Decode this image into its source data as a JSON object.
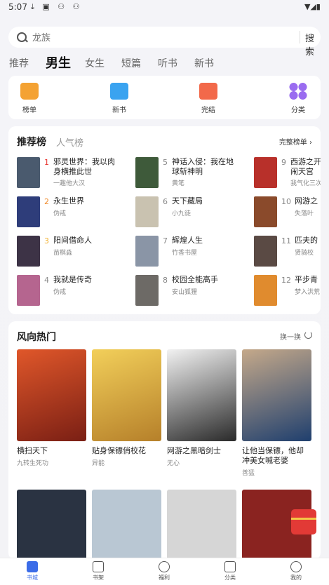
{
  "status_bar": {
    "time": "5:07",
    "notification_icons": "⤓ ▣ ⚇ ⚇"
  },
  "search": {
    "placeholder": "龙族",
    "button_label": "搜索"
  },
  "tabs": [
    {
      "label": "推荐"
    },
    {
      "label": "男生"
    },
    {
      "label": "女生"
    },
    {
      "label": "短篇"
    },
    {
      "label": "听书"
    },
    {
      "label": "新书"
    }
  ],
  "quick_links": [
    {
      "label": "榜单",
      "icon": "trophy-icon",
      "color": "#f4a233"
    },
    {
      "label": "新书",
      "icon": "new-book-icon",
      "color": "#3aa3f0"
    },
    {
      "label": "完结",
      "icon": "finished-icon",
      "color": "#f2694a"
    },
    {
      "label": "分类",
      "icon": "category-icon",
      "color": "#9a6cf0"
    }
  ],
  "rank_section": {
    "title": "推荐榜",
    "subtitle": "人气榜",
    "more_label": "完整榜单 ›",
    "items": [
      {
        "rank": "1",
        "title": "邪灵世界：我以肉\n身横推此世",
        "author": "一趣他大汉",
        "color": "#4a5a6e"
      },
      {
        "rank": "2",
        "title": "永生世界",
        "author": "伪戒",
        "color": "#2e3d7a"
      },
      {
        "rank": "3",
        "title": "阳间借命人",
        "author": "苗棋淼",
        "color": "#3d3346"
      },
      {
        "rank": "4",
        "title": "我就是传奇",
        "author": "伪戒",
        "color": "#b5658f"
      },
      {
        "rank": "5",
        "title": "神话入侵：我在地\n球斩神明",
        "author": "黄笔",
        "color": "#3e5a3a"
      },
      {
        "rank": "6",
        "title": "天下藏局",
        "author": "小九徒",
        "color": "#c9c2b0"
      },
      {
        "rank": "7",
        "title": "辉煌人生",
        "author": "竹香书屋",
        "color": "#8a95a6"
      },
      {
        "rank": "8",
        "title": "校园全能高手",
        "author": "安山狐狸",
        "color": "#6d6a66"
      },
      {
        "rank": "9",
        "title": "西游之开\n闹天宫",
        "author": "我气化三次",
        "color": "#b8302a"
      },
      {
        "rank": "10",
        "title": "网游之",
        "author": "失落叶",
        "color": "#8a4a2b"
      },
      {
        "rank": "11",
        "title": "匹夫的",
        "author": "贤骑校",
        "color": "#5a4a44"
      },
      {
        "rank": "12",
        "title": "平步青",
        "author": "梦入洪荒",
        "color": "#e08b2e"
      }
    ]
  },
  "hot_section": {
    "title": "风向热门",
    "refresh_label": "换一换",
    "books": [
      {
        "title": "横扫天下",
        "author": "九转生死功",
        "color": "#c0391f"
      },
      {
        "title": "贴身保镖俏校花",
        "author": "异能",
        "color": "#e3b23d"
      },
      {
        "title": "网游之黑暗剑士",
        "author": "无心",
        "color": "#3a3a3a"
      },
      {
        "title": "让他当保镖，他却\n冲美女喊老婆",
        "author": "善猛",
        "color": "#2f5a8a"
      }
    ],
    "more_covers": [
      {
        "color": "#2a3342"
      },
      {
        "color": "#b9c7d3"
      },
      {
        "color": "#d6d6d6"
      },
      {
        "color": "#8a2320"
      }
    ]
  },
  "bottom_nav": [
    {
      "label": "书城",
      "icon": "bookstore-icon"
    },
    {
      "label": "书架",
      "icon": "bookshelf-icon"
    },
    {
      "label": "福利",
      "icon": "welfare-icon"
    },
    {
      "label": "分类",
      "icon": "category-icon"
    },
    {
      "label": "我的",
      "icon": "profile-icon"
    }
  ]
}
